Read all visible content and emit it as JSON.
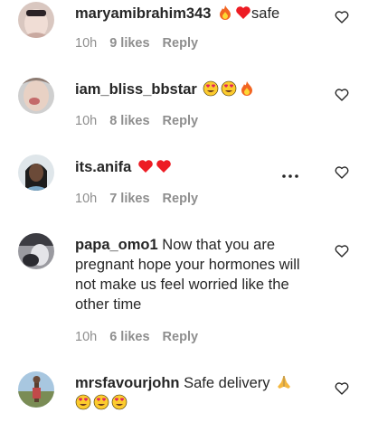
{
  "comments": [
    {
      "username": "maryamibrahim343",
      "text": "safe",
      "emojis": [
        "fire",
        "red-heart"
      ],
      "text_after_emojis": true,
      "time": "10h",
      "likes": "9 likes",
      "reply": "Reply"
    },
    {
      "username": "iam_bliss_bbstar",
      "text": "",
      "emojis": [
        "heart-eyes",
        "heart-eyes",
        "fire"
      ],
      "time": "10h",
      "likes": "8 likes",
      "reply": "Reply"
    },
    {
      "username": "its.anifa",
      "text": "",
      "emojis": [
        "red-heart",
        "red-heart"
      ],
      "time": "10h",
      "likes": "7 likes",
      "reply": "Reply"
    },
    {
      "username": "papa_omo1",
      "text": "Now that you are pregnant hope your hormones will not make us feel worried like the other time",
      "emojis": [],
      "time": "10h",
      "likes": "6 likes",
      "reply": "Reply"
    },
    {
      "username": "mrsfavourjohn",
      "text": "Safe delivery",
      "emojis": [
        "folded-hands",
        "heart-eyes",
        "heart-eyes",
        "heart-eyes"
      ],
      "time": "",
      "likes": "",
      "reply": ""
    }
  ],
  "colors": {
    "text": "#262626",
    "meta": "#8e8e8e",
    "heart_red": "#ed1c24",
    "fire_orange": "#f26522"
  },
  "icons": {
    "like": "heart-outline-icon",
    "more": "more-options-icon"
  }
}
